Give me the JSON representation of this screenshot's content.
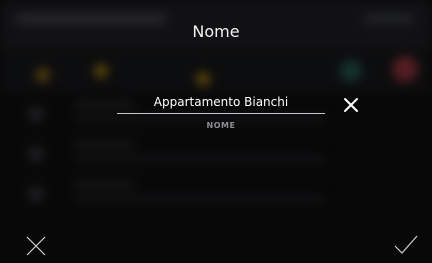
{
  "modal": {
    "title": "Nome",
    "field": {
      "value": "Appartamento Bianchi",
      "label": "NOME"
    }
  },
  "icons": {
    "clear": "close-icon",
    "cancel": "close-icon",
    "confirm": "checkmark-icon"
  },
  "colors": {
    "text": "#ffffff",
    "label": "#8e8e93",
    "background": "#121214"
  }
}
